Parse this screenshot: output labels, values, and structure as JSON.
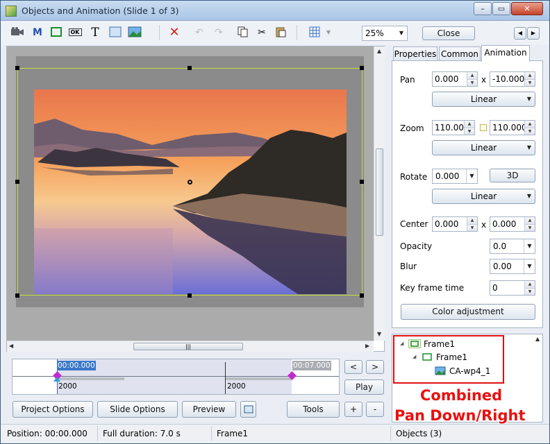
{
  "window": {
    "title": "Objects and Animation  (Slide 1 of 3)",
    "minimize": "–",
    "maximize": "▭",
    "close": "✕"
  },
  "toolbar": {
    "m_label": "M",
    "ok_label": "OK",
    "text_label": "T",
    "zoom": "25%",
    "close_label": "Close"
  },
  "tabs": [
    "Properties",
    "Common",
    "Animation"
  ],
  "animation": {
    "pan_label": "Pan",
    "pan_x": "0.000",
    "pan_sep": "x",
    "pan_y": "-10.000",
    "pan_mode": "Linear",
    "zoom_label": "Zoom",
    "zoom_x": "110.000",
    "zoom_y": "110.000",
    "zoom_mode": "Linear",
    "rotate_label": "Rotate",
    "rotate_value": "0.000",
    "rotate_3d": "3D",
    "rotate_mode": "Linear",
    "center_label": "Center",
    "center_x": "0.000",
    "center_sep": "x",
    "center_y": "0.000",
    "opacity_label": "Opacity",
    "opacity_value": "0.0",
    "blur_label": "Blur",
    "blur_value": "0.00",
    "keyframe_label": "Key frame time",
    "keyframe_value": "0",
    "color_adjust": "Color adjustment"
  },
  "tree": {
    "root": "Frame1",
    "child": "Frame1",
    "image": "CA-wp4_1"
  },
  "timeline": {
    "start_time": "00:00.000",
    "end_time": "00:07.000",
    "dur1": "2000",
    "dur2": "2000",
    "play": "Play",
    "prev": "<",
    "next": ">",
    "plus": "+",
    "minus": "-"
  },
  "bottom_buttons": {
    "project_options": "Project Options",
    "slide_options": "Slide Options",
    "preview": "Preview",
    "tools": "Tools"
  },
  "status": {
    "position": "Position:  00:00.000",
    "duration": "Full duration:  7.0 s",
    "object": "Frame1",
    "objects": "Objects (3)"
  },
  "annotation": {
    "line1": "Combined",
    "line2": "Pan Down/Right"
  },
  "colors": {
    "annotation_red": "#e81010",
    "selection": "#c6df3a",
    "highlight_blue": "#3a77c9"
  }
}
